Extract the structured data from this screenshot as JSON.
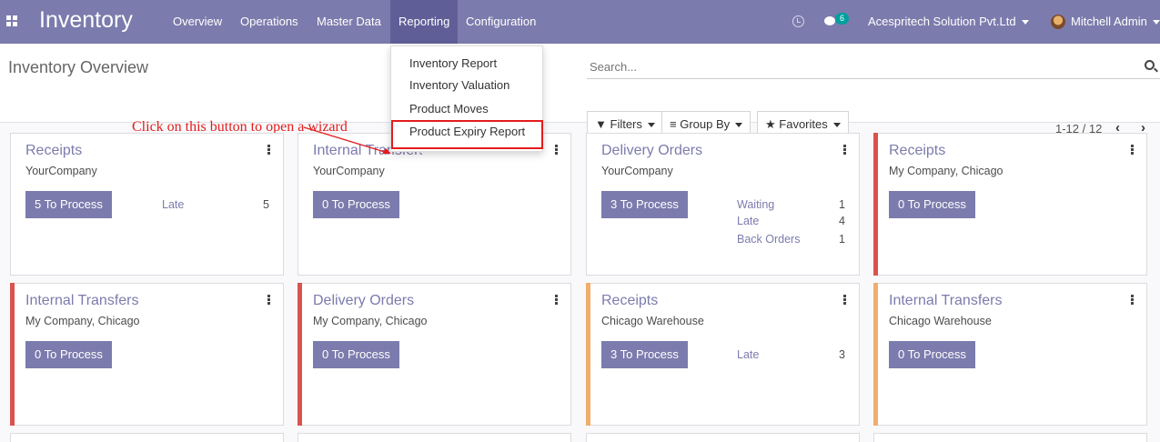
{
  "navbar": {
    "app_name": "Inventory",
    "menus": [
      "Overview",
      "Operations",
      "Master Data",
      "Reporting",
      "Configuration"
    ],
    "chat_badge": "6",
    "company": "Acespritech Solution Pvt.Ltd",
    "user": "Mitchell Admin",
    "colors": {
      "primary": "#7c7bad",
      "active": "#5f5e97"
    }
  },
  "control": {
    "title": "Inventory Overview",
    "search_placeholder": "Search...",
    "filters_label": "Filters",
    "group_by_label": "Group By",
    "favorites_label": "Favorites",
    "pager": "1-12 / 12"
  },
  "reporting_menu": {
    "items": [
      "Inventory Report",
      "Inventory Valuation",
      "Product Moves",
      "Product Expiry Report"
    ],
    "highlight_color": "#e31c1c"
  },
  "annotation": "Click on this button to open a wizard",
  "cards": [
    {
      "title": "Receipts",
      "subtitle": "YourCompany",
      "button": "5 To Process",
      "stats": [
        {
          "label": "Late",
          "value": "5"
        }
      ],
      "bar": ""
    },
    {
      "title": "Internal Transfers",
      "subtitle": "YourCompany",
      "button": "0 To Process",
      "stats": [],
      "bar": ""
    },
    {
      "title": "Delivery Orders",
      "subtitle": "YourCompany",
      "button": "3 To Process",
      "stats": [
        {
          "label": "Waiting",
          "value": "1"
        },
        {
          "label": "Late",
          "value": "4"
        },
        {
          "label": "Back Orders",
          "value": "1"
        }
      ],
      "bar": ""
    },
    {
      "title": "Receipts",
      "subtitle": "My Company, Chicago",
      "button": "0 To Process",
      "stats": [],
      "bar": "#d9534f"
    },
    {
      "title": "Internal Transfers",
      "subtitle": "My Company, Chicago",
      "button": "0 To Process",
      "stats": [],
      "bar": "#d9534f"
    },
    {
      "title": "Delivery Orders",
      "subtitle": "My Company, Chicago",
      "button": "0 To Process",
      "stats": [],
      "bar": "#d9534f"
    },
    {
      "title": "Receipts",
      "subtitle": "Chicago Warehouse",
      "button": "3 To Process",
      "stats": [
        {
          "label": "Late",
          "value": "3"
        }
      ],
      "bar": "#f0ad6e"
    },
    {
      "title": "Internal Transfers",
      "subtitle": "Chicago Warehouse",
      "button": "0 To Process",
      "stats": [],
      "bar": "#f0ad6e"
    }
  ]
}
